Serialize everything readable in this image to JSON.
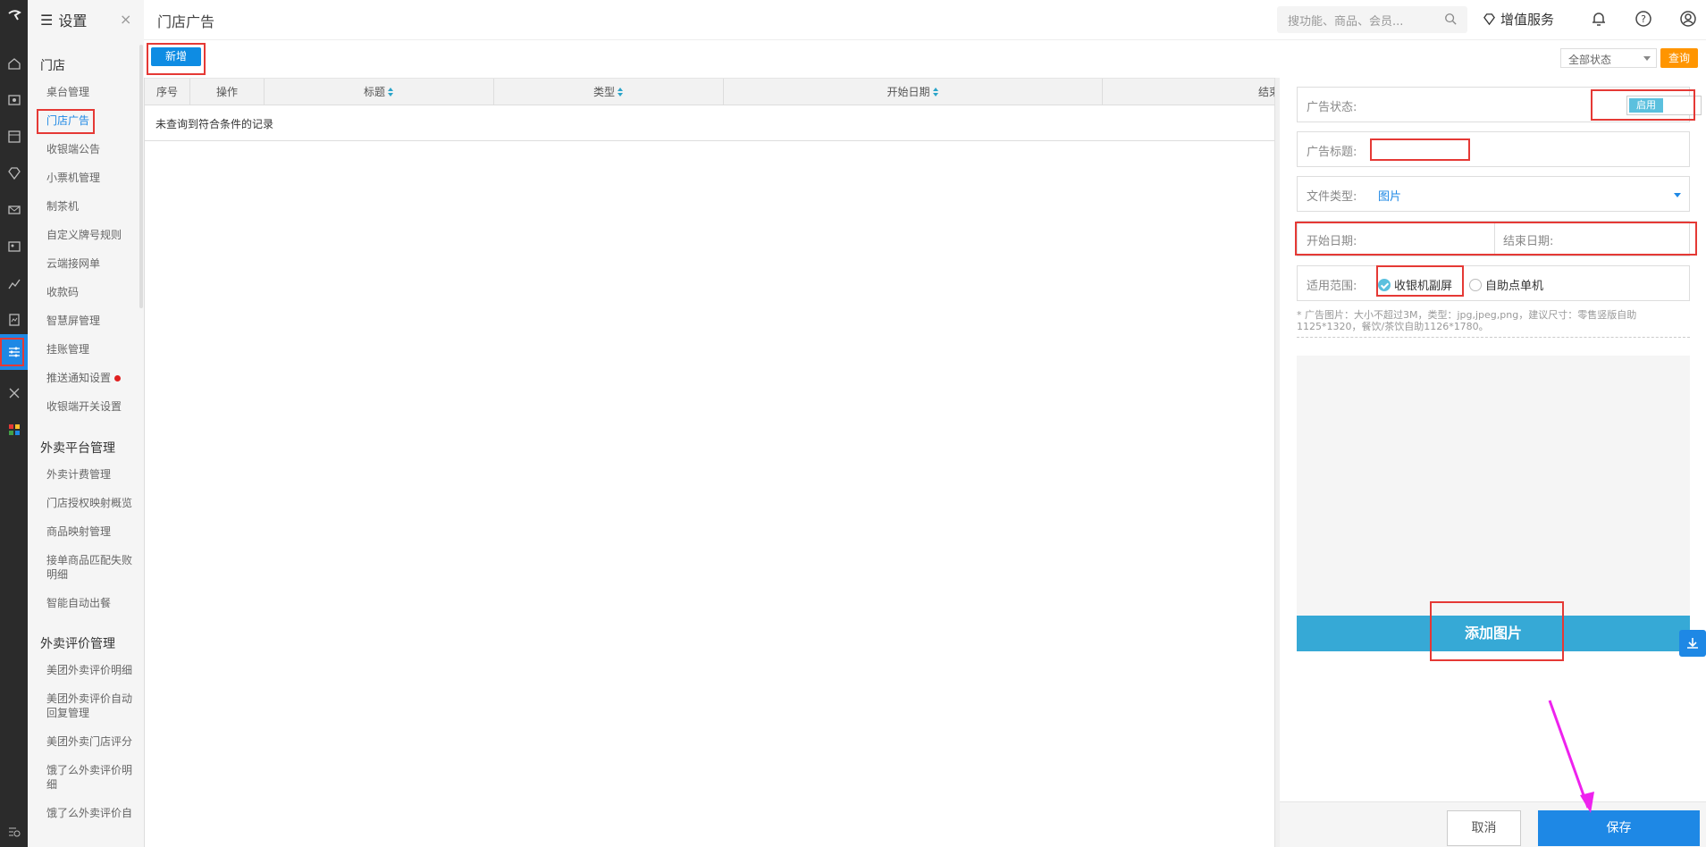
{
  "sidebar": {
    "title": "设置",
    "close": "×",
    "groups": [
      {
        "label": "门店"
      },
      {
        "label": "外卖平台管理"
      },
      {
        "label": "外卖评价管理"
      }
    ],
    "items": [
      "桌台管理",
      "门店广告",
      "收银端公告",
      "小票机管理",
      "制茶机",
      "自定义牌号规则",
      "云端接网单",
      "收款码",
      "智慧屏管理",
      "挂账管理",
      "推送通知设置",
      "收银端开关设置",
      "外卖计费管理",
      "门店授权映射概览",
      "商品映射管理",
      "接单商品匹配失败明细",
      "智能自动出餐",
      "美团外卖评价明细",
      "美团外卖评价自动回复管理",
      "美团外卖门店评分",
      "饿了么外卖评价明细",
      "饿了么外卖评价自"
    ]
  },
  "topbar": {
    "title": "门店广告",
    "search_placeholder": "搜功能、商品、会员...",
    "vip_label": "增值服务"
  },
  "toolbar": {
    "add_label": "新增",
    "status_value": "全部状态",
    "query_label": "查询"
  },
  "table": {
    "headers": [
      "序号",
      "操作",
      "标题",
      "类型",
      "开始日期",
      "结束"
    ],
    "empty_text": "未查询到符合条件的记录"
  },
  "form": {
    "status_label": "广告状态:",
    "status_on": "启用",
    "title_label": "广告标题:",
    "filetype_label": "文件类型:",
    "filetype_value": "图片",
    "start_label": "开始日期:",
    "end_label": "结束日期:",
    "scope_label": "适用范围:",
    "scope_opt1": "收银机副屏",
    "scope_opt2": "自助点单机",
    "hint": "* 广告图片：大小不超过3M，类型：jpg,jpeg,png，建议尺寸：零售竖版自助1125*1320，餐饮/茶饮自助1126*1780。",
    "add_image": "添加图片",
    "cancel": "取消",
    "save": "保存"
  },
  "colors": {
    "accent": "#1e88e5",
    "highlight": "#e53935",
    "query": "#ff9500",
    "arrow": "#ee22ee"
  }
}
